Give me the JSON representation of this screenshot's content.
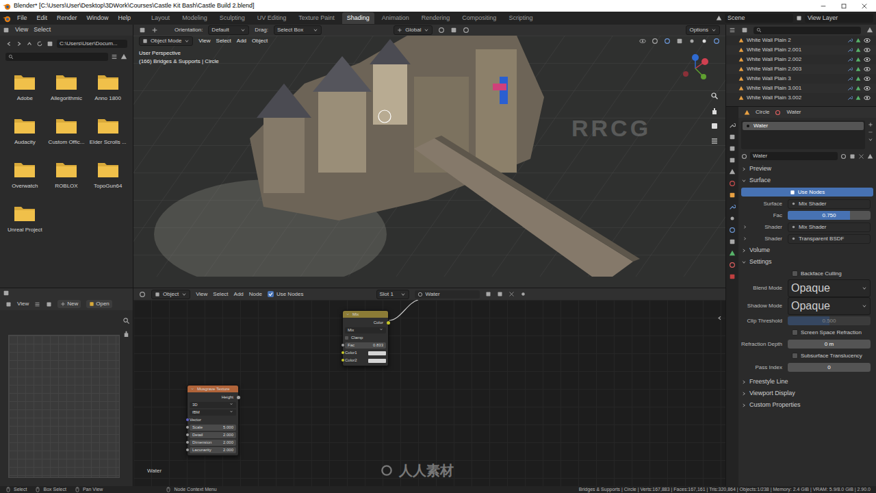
{
  "window": {
    "title": "Blender* [C:\\Users\\User\\Desktop\\3DWork\\Courses\\Castle Kit Bash\\Castle Build 2.blend]"
  },
  "menu": [
    "File",
    "Edit",
    "Render",
    "Window",
    "Help"
  ],
  "workspaces": [
    {
      "label": "Layout",
      "selected": false
    },
    {
      "label": "Modeling",
      "selected": false
    },
    {
      "label": "Sculpting",
      "selected": false
    },
    {
      "label": "UV Editing",
      "selected": false
    },
    {
      "label": "Texture Paint",
      "selected": false
    },
    {
      "label": "Shading",
      "selected": true
    },
    {
      "label": "Animation",
      "selected": false
    },
    {
      "label": "Rendering",
      "selected": false
    },
    {
      "label": "Compositing",
      "selected": false
    },
    {
      "label": "Scripting",
      "selected": false
    }
  ],
  "scene": "Scene",
  "view_layer": "View Layer",
  "watermarks": [
    "RRCG",
    "人人素材"
  ],
  "file_browser": {
    "menu": [
      "View",
      "Select"
    ],
    "path": "C:\\Users\\User\\Docum...",
    "folders": [
      "Adobe",
      "Allegorithmic",
      "Anno 1800",
      "Audacity",
      "Custom Offic...",
      "Elder Scrolls ...",
      "Overwatch",
      "ROBLOX",
      "TopoGun64",
      "Unreal Project"
    ]
  },
  "image_editor": {
    "menu": [
      "View"
    ],
    "new": "New",
    "open": "Open"
  },
  "viewport": {
    "orientation_label": "Orientation:",
    "orientation": "Default",
    "drag_label": "Drag:",
    "drag": "Select Box",
    "transform": "Global",
    "options": "Options",
    "mode": "Object Mode",
    "menu": [
      "View",
      "Select",
      "Add",
      "Object"
    ],
    "perspective": "User Perspective",
    "info": "(166) Bridges & Supports | Circle"
  },
  "node_editor": {
    "type": "Object",
    "menu": [
      "View",
      "Select",
      "Add",
      "Node"
    ],
    "use_nodes": {
      "label": "Use Nodes",
      "checked": true
    },
    "slot": "Slot 1",
    "material": "Water",
    "frame_label": "Water",
    "mix_node": {
      "title": "Mix",
      "output": "Color",
      "blend": "Mix",
      "clamp": {
        "label": "Clamp",
        "checked": false
      },
      "fac": {
        "label": "Fac",
        "value": "0.833"
      },
      "inputs": [
        "Color1",
        "Color2"
      ]
    },
    "musgrave_node": {
      "title": "Musgrave Texture",
      "output": "Height",
      "dimensions": "3D",
      "type": "fBM",
      "vector": "Vector",
      "fields": [
        {
          "label": "Scale",
          "value": "5.000"
        },
        {
          "label": "Detail",
          "value": "2.000"
        },
        {
          "label": "Dimension",
          "value": "2.000"
        },
        {
          "label": "Lacunarity",
          "value": "2.000"
        }
      ]
    }
  },
  "outliner": {
    "items": [
      {
        "label": "White Wall Plain 2",
        "visible": true
      },
      {
        "label": "White Wall Plain 2.001",
        "visible": true
      },
      {
        "label": "White Wall Plain 2.002",
        "visible": true
      },
      {
        "label": "White Wall Plain 2.003",
        "visible": true
      },
      {
        "label": "White Wall Plain 3",
        "visible": true
      },
      {
        "label": "White Wall Plain 3.001",
        "visible": true
      },
      {
        "label": "White Wall Plain 3.002",
        "visible": true
      }
    ]
  },
  "properties": {
    "object": "Circle",
    "material": "Water",
    "slots": [
      {
        "label": "Water",
        "selected": true
      }
    ],
    "datablock": "Water",
    "preview": {
      "label": "Preview",
      "expanded": false
    },
    "surface": {
      "label": "Surface",
      "expanded": true,
      "use_nodes": {
        "label": "Use Nodes",
        "on": true
      },
      "rows": [
        {
          "kind": "link",
          "label": "Surface",
          "value": "Mix Shader",
          "expanded": false
        },
        {
          "kind": "slider",
          "label": "Fac",
          "value": "0.750",
          "level": 0.75
        },
        {
          "kind": "link",
          "label": "Shader",
          "value": "Mix Shader",
          "expanded": false
        },
        {
          "kind": "link",
          "label": "Shader",
          "value": "Transparent BSDF",
          "expanded": false
        }
      ]
    },
    "volume": {
      "label": "Volume",
      "expanded": false
    },
    "settings": {
      "label": "Settings",
      "expanded": true,
      "rows": [
        {
          "kind": "checkbox",
          "label": "Backface Culling",
          "checked": false
        },
        {
          "kind": "dropdown",
          "label": "Blend Mode",
          "value": "Opaque"
        },
        {
          "kind": "dropdown",
          "label": "Shadow Mode",
          "value": "Opaque"
        },
        {
          "kind": "slider",
          "label": "Clip Threshold",
          "value": "0.500",
          "level": 0.5,
          "disabled": true
        },
        {
          "kind": "checkbox",
          "label": "Screen Space Refraction",
          "checked": false
        },
        {
          "kind": "field",
          "label": "Refraction Depth",
          "value": "0 m"
        },
        {
          "kind": "checkbox",
          "label": "Subsurface Translucency",
          "checked": false
        },
        {
          "kind": "field",
          "label": "Pass Index",
          "value": "0"
        }
      ]
    },
    "closed_sections": [
      {
        "label": "Freestyle Line",
        "expanded": false
      },
      {
        "label": "Viewport Display",
        "expanded": false
      },
      {
        "label": "Custom Properties",
        "expanded": false
      }
    ]
  },
  "status_bar": {
    "hints": [
      "Select",
      "Box Select",
      "Pan View",
      "Node Context Menu"
    ],
    "info": "Bridges & Supports | Circle | Verts:167,883 | Faces:167,161 | Tris:320,864 | Objects:1/238 | Memory: 2.4 GiB | VRAM: 5.9/8.0 GiB | 2.90.0"
  }
}
